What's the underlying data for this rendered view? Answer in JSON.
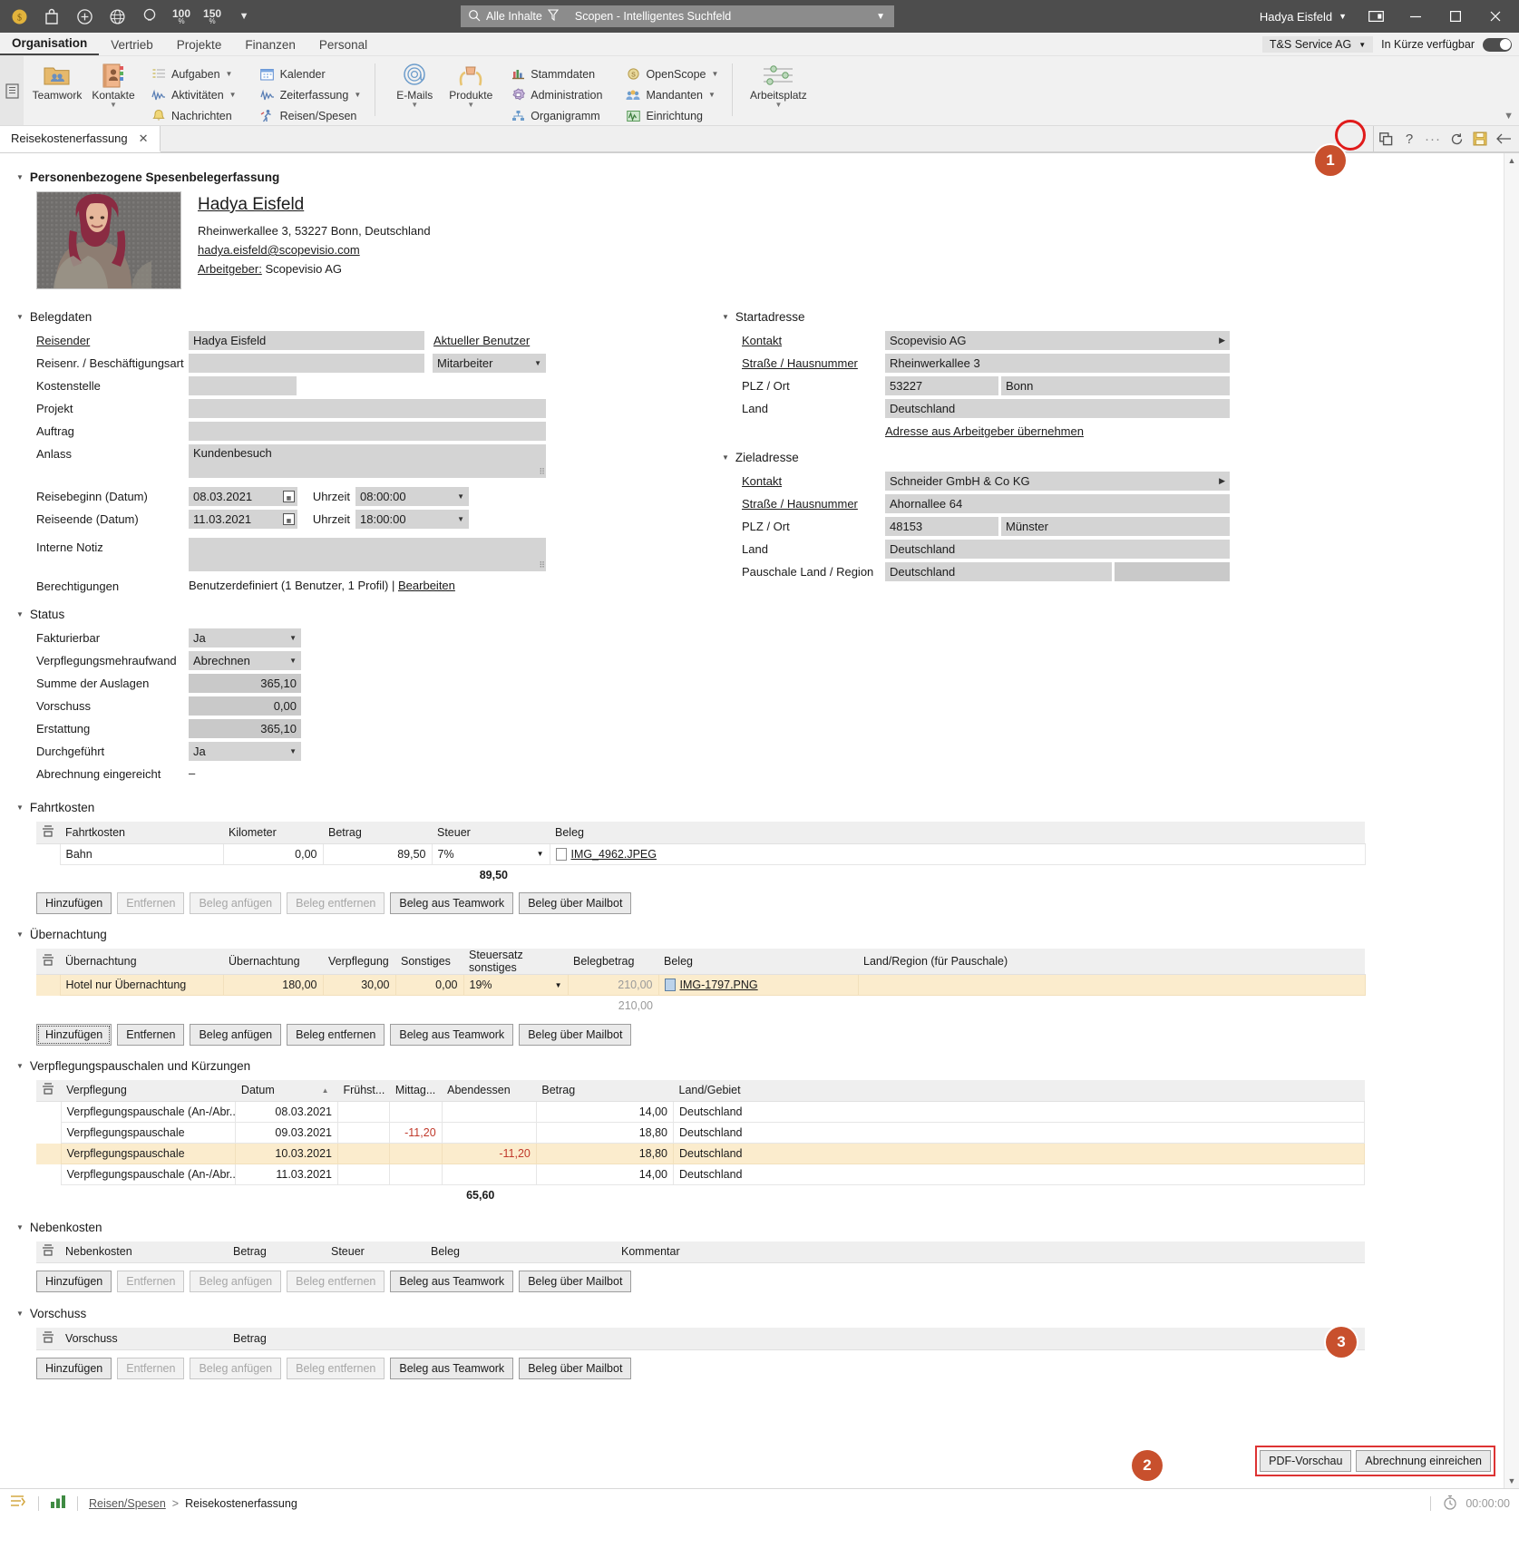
{
  "titlebar": {
    "icons": [
      "coin-icon",
      "bag-icon",
      "plus-circle-icon",
      "globe-icon",
      "bulb-icon"
    ],
    "zoom_100": "100",
    "zoom_100_unit": "%",
    "zoom_150": "150",
    "zoom_150_unit": "%",
    "overflow_caret": "▼",
    "search": {
      "scope": "Alle Inhalte",
      "placeholder": "Scopen - Intelligentes Suchfeld",
      "caret": "▼"
    },
    "user": "Hadya Eisfeld",
    "user_caret": "▼",
    "window_buttons": {
      "minimize": "—",
      "maximize": "□",
      "close": "✕"
    }
  },
  "ribbon": {
    "tabs": [
      {
        "label": "Organisation",
        "active": true
      },
      {
        "label": "Vertrieb",
        "active": false
      },
      {
        "label": "Projekte",
        "active": false
      },
      {
        "label": "Finanzen",
        "active": false
      },
      {
        "label": "Personal",
        "active": false
      }
    ],
    "company": "T&S Service AG",
    "company_caret": "▼",
    "availability": "In Kürze verfügbar",
    "groups": {
      "big1": [
        {
          "label": "Teamwork",
          "icon": "teamwork-folder-icon",
          "caret": ""
        },
        {
          "label": "Kontakte",
          "icon": "contacts-book-icon",
          "caret": "▼"
        }
      ],
      "small1": [
        {
          "label": "Aufgaben",
          "icon": "tasks-icon",
          "caret": "▼"
        },
        {
          "label": "Aktivitäten",
          "icon": "activities-icon",
          "caret": "▼"
        },
        {
          "label": "Nachrichten",
          "icon": "bell-icon",
          "caret": ""
        }
      ],
      "small2": [
        {
          "label": "Kalender",
          "icon": "calendar-icon",
          "caret": ""
        },
        {
          "label": "Zeiterfassung",
          "icon": "timetracking-icon",
          "caret": "▼"
        },
        {
          "label": "Reisen/Spesen",
          "icon": "travel-icon",
          "caret": ""
        }
      ],
      "big2": [
        {
          "label": "E-Mails",
          "icon": "at-fingerprint-icon",
          "caret": "▼"
        },
        {
          "label": "Produkte",
          "icon": "product-hands-icon",
          "caret": "▼"
        }
      ],
      "small3": [
        {
          "label": "Stammdaten",
          "icon": "masterdata-icon",
          "caret": ""
        },
        {
          "label": "Administration",
          "icon": "administration-icon",
          "caret": ""
        },
        {
          "label": "Organigramm",
          "icon": "orgchart-icon",
          "caret": ""
        }
      ],
      "small4": [
        {
          "label": "OpenScope",
          "icon": "openscope-icon",
          "caret": "▼"
        },
        {
          "label": "Mandanten",
          "icon": "clients-icon",
          "caret": "▼"
        },
        {
          "label": "Einrichtung",
          "icon": "setup-icon",
          "caret": ""
        }
      ],
      "big3": [
        {
          "label": "Arbeitsplatz",
          "icon": "sliders-icon",
          "caret": "▼"
        }
      ]
    }
  },
  "doctabs": {
    "active_tab": "Reisekostenerfassung",
    "close_glyph": "✕",
    "tools": [
      "duplicate-icon",
      "help-icon",
      "more-icon",
      "refresh-icon",
      "save-icon",
      "back-arrow-icon"
    ]
  },
  "page": {
    "section_person": "Personenbezogene Spesenbelegerfassung",
    "person": {
      "name": "Hadya Eisfeld",
      "address": "Rheinwerkallee 3, 53227 Bonn, Deutschland",
      "email": "hadya.eisfeld@scopevisio.com",
      "employer_label": "Arbeitgeber:",
      "employer_value": "Scopevisio AG"
    },
    "belegdaten": {
      "title": "Belegdaten",
      "reisender_label": "Reisender",
      "reisender_value": "Hadya Eisfeld",
      "aktueller_benutzer_link": "Aktueller Benutzer",
      "reisenr_label": "Reisenr. / Beschäftigungsart",
      "reisenr_value": "",
      "beschaeftigungsart_value": "Mitarbeiter",
      "kostenstelle_label": "Kostenstelle",
      "kostenstelle_value": "",
      "projekt_label": "Projekt",
      "projekt_value": "",
      "auftrag_label": "Auftrag",
      "auftrag_value": "",
      "anlass_label": "Anlass",
      "anlass_value": "Kundenbesuch",
      "reisebeginn_label": "Reisebeginn (Datum)",
      "reisebeginn_value": "08.03.2021",
      "uhrzeit_label": "Uhrzeit",
      "reisebeginn_time": "08:00:00",
      "reiseende_label": "Reiseende (Datum)",
      "reiseende_value": "11.03.2021",
      "reiseende_time": "18:00:00",
      "notiz_label": "Interne Notiz",
      "notiz_value": "",
      "berechtigungen_label": "Berechtigungen",
      "berechtigungen_value": "Benutzerdefiniert (1 Benutzer, 1 Profil) |",
      "berechtigungen_link": "Bearbeiten"
    },
    "startadresse": {
      "title": "Startadresse",
      "kontakt_label": "Kontakt",
      "kontakt_value": "Scopevisio AG",
      "strasse_label": "Straße / Hausnummer",
      "strasse_value": "Rheinwerkallee 3",
      "plz_label": "PLZ / Ort",
      "plz_value": "53227",
      "ort_value": "Bonn",
      "land_label": "Land",
      "land_value": "Deutschland",
      "uebernehmen_link": "Adresse aus Arbeitgeber übernehmen"
    },
    "zieladresse": {
      "title": "Zieladresse",
      "kontakt_label": "Kontakt",
      "kontakt_value": "Schneider GmbH & Co KG",
      "strasse_label": "Straße / Hausnummer",
      "strasse_value": "Ahornallee 64",
      "plz_label": "PLZ / Ort",
      "plz_value": "48153",
      "ort_value": "Münster",
      "land_label": "Land",
      "land_value": "Deutschland",
      "pauschale_label": "Pauschale Land / Region",
      "pauschale_value": "Deutschland",
      "pauschale_region_value": ""
    },
    "status": {
      "title": "Status",
      "rows": [
        {
          "label": "Fakturierbar",
          "value": "Ja",
          "type": "select"
        },
        {
          "label": "Verpflegungsmehraufwand",
          "value": "Abrechnen",
          "type": "select"
        },
        {
          "label": "Summe der Auslagen",
          "value": "365,10",
          "type": "num"
        },
        {
          "label": "Vorschuss",
          "value": "0,00",
          "type": "num"
        },
        {
          "label": "Erstattung",
          "value": "365,10",
          "type": "num"
        },
        {
          "label": "Durchgeführt",
          "value": "Ja",
          "type": "select"
        },
        {
          "label": "Abrechnung eingereicht",
          "value": "–",
          "type": "text"
        }
      ]
    },
    "fahrtkosten": {
      "title": "Fahrtkosten",
      "columns": [
        "Fahrtkosten",
        "Kilometer",
        "Betrag",
        "Steuer",
        "Beleg"
      ],
      "rows": [
        {
          "art": "Bahn",
          "kilometer": "0,00",
          "betrag": "89,50",
          "steuer": "7%",
          "beleg": "IMG_4962.JPEG"
        }
      ],
      "total": "89,50",
      "buttons": [
        {
          "label": "Hinzufügen",
          "disabled": false
        },
        {
          "label": "Entfernen",
          "disabled": true
        },
        {
          "label": "Beleg anfügen",
          "disabled": true
        },
        {
          "label": "Beleg entfernen",
          "disabled": true
        },
        {
          "label": "Beleg aus Teamwork",
          "disabled": false
        },
        {
          "label": "Beleg über Mailbot",
          "disabled": false
        }
      ]
    },
    "uebernachtung": {
      "title": "Übernachtung",
      "columns": [
        "Übernachtung",
        "Übernachtung",
        "Verpflegung",
        "Sonstiges",
        "Steuersatz sonstiges",
        "Belegbetrag",
        "Beleg",
        "Land/Region (für Pauschale)"
      ],
      "rows": [
        {
          "art": "Hotel nur Übernachtung",
          "uebernachtung": "180,00",
          "verpflegung": "30,00",
          "sonstiges": "0,00",
          "steuersatz": "19%",
          "belegbetrag": "210,00",
          "beleg": "IMG-1797.PNG",
          "land": ""
        }
      ],
      "total": "210,00",
      "buttons": [
        {
          "label": "Hinzufügen",
          "disabled": false
        },
        {
          "label": "Entfernen",
          "disabled": false
        },
        {
          "label": "Beleg anfügen",
          "disabled": false
        },
        {
          "label": "Beleg entfernen",
          "disabled": false
        },
        {
          "label": "Beleg aus Teamwork",
          "disabled": false
        },
        {
          "label": "Beleg über Mailbot",
          "disabled": false
        }
      ]
    },
    "verpflegung": {
      "title": "Verpflegungspauschalen und Kürzungen",
      "columns": [
        "Verpflegung",
        "Datum",
        "Frühst...",
        "Mittag...",
        "Abendessen",
        "Betrag",
        "Land/Gebiet"
      ],
      "sort_indicator": "▲",
      "rows": [
        {
          "art": "Verpflegungspauschale (An-/Abr...",
          "datum": "08.03.2021",
          "fruehstueck": "",
          "mittag": "",
          "abend": "",
          "betrag": "14,00",
          "land": "Deutschland",
          "highlight": false
        },
        {
          "art": "Verpflegungspauschale",
          "datum": "09.03.2021",
          "fruehstueck": "",
          "mittag": "-11,20",
          "abend": "",
          "betrag": "18,80",
          "land": "Deutschland",
          "highlight": false
        },
        {
          "art": "Verpflegungspauschale",
          "datum": "10.03.2021",
          "fruehstueck": "",
          "mittag": "",
          "abend": "-11,20",
          "betrag": "18,80",
          "land": "Deutschland",
          "highlight": true
        },
        {
          "art": "Verpflegungspauschale (An-/Abr...",
          "datum": "11.03.2021",
          "fruehstueck": "",
          "mittag": "",
          "abend": "",
          "betrag": "14,00",
          "land": "Deutschland",
          "highlight": false
        }
      ],
      "total": "65,60"
    },
    "nebenkosten": {
      "title": "Nebenkosten",
      "columns": [
        "Nebenkosten",
        "Betrag",
        "Steuer",
        "Beleg",
        "Kommentar"
      ],
      "buttons": [
        {
          "label": "Hinzufügen",
          "disabled": false
        },
        {
          "label": "Entfernen",
          "disabled": true
        },
        {
          "label": "Beleg anfügen",
          "disabled": true
        },
        {
          "label": "Beleg entfernen",
          "disabled": true
        },
        {
          "label": "Beleg aus Teamwork",
          "disabled": false
        },
        {
          "label": "Beleg über Mailbot",
          "disabled": false
        }
      ]
    },
    "vorschuss": {
      "title": "Vorschuss",
      "columns": [
        "Vorschuss",
        "Betrag"
      ],
      "buttons": [
        {
          "label": "Hinzufügen",
          "disabled": false
        },
        {
          "label": "Entfernen",
          "disabled": true
        },
        {
          "label": "Beleg anfügen",
          "disabled": true
        },
        {
          "label": "Beleg entfernen",
          "disabled": true
        },
        {
          "label": "Beleg aus Teamwork",
          "disabled": false
        },
        {
          "label": "Beleg über Mailbot",
          "disabled": false
        }
      ]
    },
    "bottom_actions": [
      {
        "label": "PDF-Vorschau"
      },
      {
        "label": "Abrechnung einreichen"
      }
    ]
  },
  "statusbar": {
    "breadcrumb_root": "Reisen/Spesen",
    "breadcrumb_sep": ">",
    "breadcrumb_current": "Reisekostenerfassung",
    "timer": "00:00:00"
  },
  "callouts": [
    {
      "number": "1"
    },
    {
      "number": "2"
    },
    {
      "number": "3"
    }
  ],
  "colors": {
    "titlebar_bg": "#4d4d4d",
    "ribbon_bg": "#f1f1f1",
    "field_bg": "#d4d4d4",
    "field_readonly_bg": "#c9c9c9",
    "highlight_row": "#fbeccd",
    "callout": "#c8502d",
    "annotation_ring": "#e01b1b",
    "negative_amount": "#c0392b"
  }
}
